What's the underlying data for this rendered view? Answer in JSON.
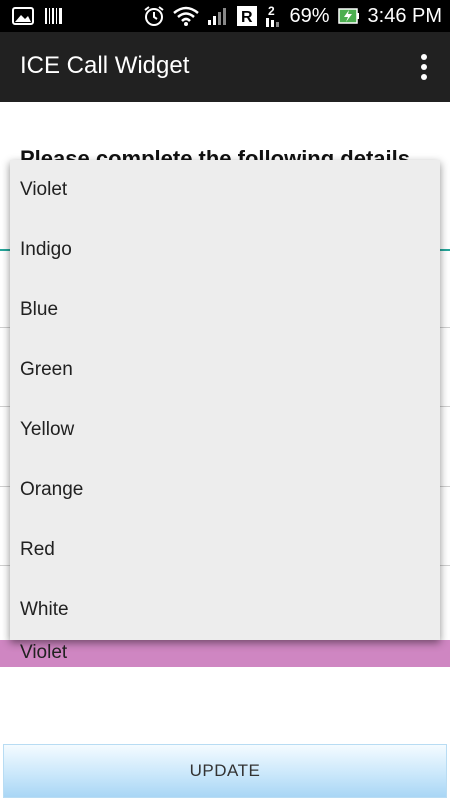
{
  "status_bar": {
    "battery_percent": "69%",
    "time": "3:46 PM",
    "icons": [
      "image-icon",
      "barcode-icon",
      "alarm-icon",
      "wifi-icon",
      "signal-icon",
      "roaming-r-icon",
      "sim2-icon",
      "battery-charging-icon"
    ]
  },
  "app_bar": {
    "title": "ICE Call Widget",
    "overflow_icon": "more-vert-icon"
  },
  "background": {
    "heading": "Please complete the following details"
  },
  "dropdown": {
    "items": [
      "Violet",
      "Indigo",
      "Blue",
      "Green",
      "Yellow",
      "Orange",
      "Red",
      "White"
    ]
  },
  "selected": {
    "value": "Violet",
    "color": "#cf86c2"
  },
  "update_button": {
    "label": "UPDATE"
  },
  "colors": {
    "app_bar": "#212121",
    "status_bar": "#000000",
    "dropdown_bg": "#ededed",
    "accent_line": "#26a69a"
  }
}
